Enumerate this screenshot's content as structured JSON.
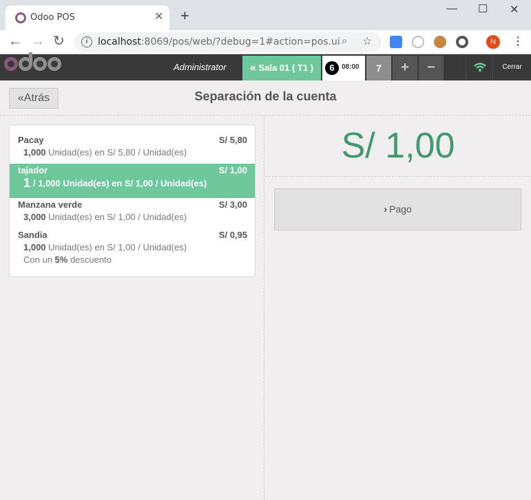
{
  "browser": {
    "tab_title": "Odoo POS",
    "url_host": "localhost",
    "url_rest": ":8069/pos/web/?debug=1#action=pos.ui",
    "profile_initial": "N"
  },
  "header": {
    "username": "Administrator",
    "table_button": "Sala 01 ( T1 )",
    "order_number": "6",
    "order_time": "08:00",
    "guests": "7",
    "plus": "+",
    "minus": "−",
    "close": "Cerrar"
  },
  "screen": {
    "back_label": "Atrás",
    "title": "Separación de la cuenta",
    "total": "S/ 1,00",
    "pay_label": "Pago"
  },
  "orderlines": [
    {
      "name": "Pacay",
      "price": "S/ 5,80",
      "qty": "1,000",
      "info": " Unidad(es) en S/ 5,80 / Unidad(es)",
      "selected": false
    },
    {
      "name": "tajador",
      "price": "S/ 1,00",
      "selected_qty": "1",
      "qty": "/ 1,000",
      "info": " Unidad(es) en S/ 1,00 / Unidad(es)",
      "selected": true
    },
    {
      "name": "Manzana verde",
      "price": "S/ 3,00",
      "qty": "3,000",
      "info": " Unidad(es) en S/ 1,00 / Unidad(es)",
      "selected": false
    },
    {
      "name": "Sandia",
      "price": "S/ 0,95",
      "qty": "1,000",
      "info": " Unidad(es) en S/ 1,00 / Unidad(es)",
      "discount_prefix": "Con un ",
      "discount_value": "5%",
      "discount_suffix": " descuento",
      "selected": false
    }
  ],
  "colors": {
    "accent": "#6ec89b",
    "total": "#43996e",
    "header": "#393939",
    "brand": "#875a7b"
  }
}
